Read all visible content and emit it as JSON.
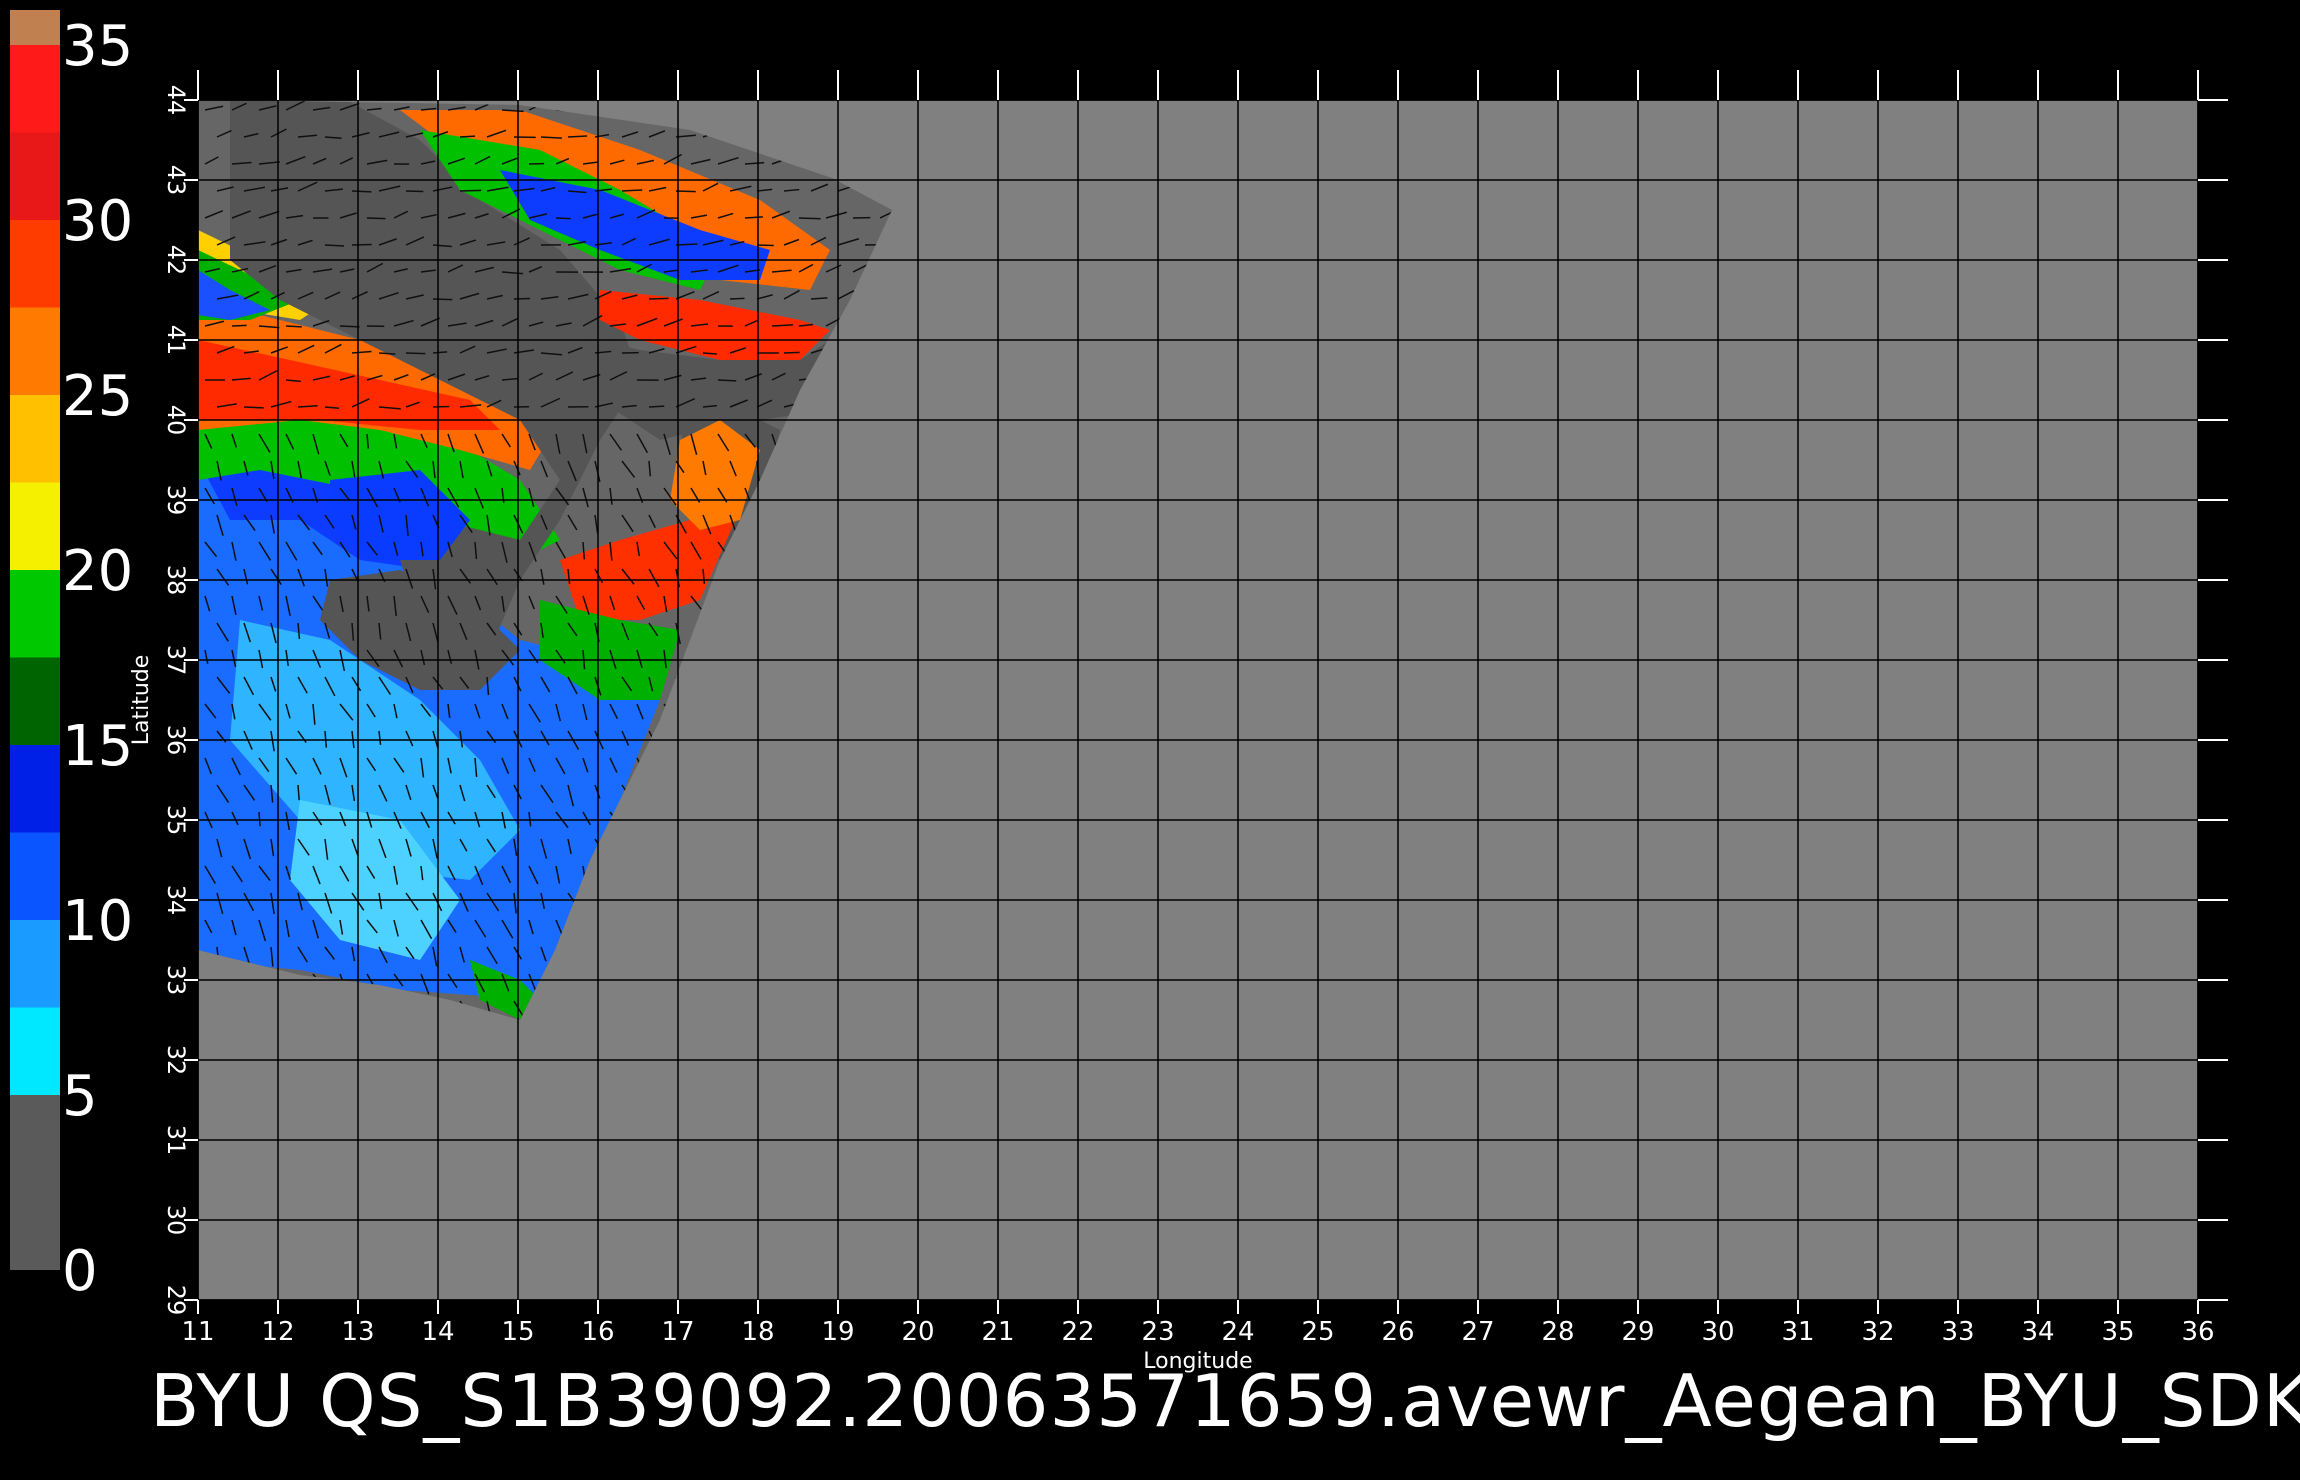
{
  "map": {
    "xlabel": "Longitude",
    "ylabel": "Latitude",
    "xlim": [
      11,
      36
    ],
    "ylim": [
      29,
      44
    ],
    "x_ticks": [
      "11",
      "12",
      "13",
      "14",
      "15",
      "16",
      "17",
      "18",
      "19",
      "20",
      "21",
      "22",
      "23",
      "24",
      "25",
      "26",
      "27",
      "28",
      "29",
      "30",
      "31",
      "32",
      "33",
      "34",
      "35",
      "36"
    ],
    "y_ticks": [
      "29",
      "30",
      "31",
      "32",
      "33",
      "34",
      "35",
      "36",
      "37",
      "38",
      "39",
      "40",
      "41",
      "42",
      "43",
      "44"
    ],
    "grid": true,
    "background_color": "#808080",
    "land_color": "#555555"
  },
  "colorbar": {
    "ticks": [
      "0",
      "5",
      "10",
      "15",
      "20",
      "25",
      "30",
      "35"
    ],
    "range": [
      0,
      35
    ],
    "segments": [
      {
        "from": 0,
        "to": 5,
        "color": "#5a5a5a"
      },
      {
        "from": 5,
        "to": 7.5,
        "color": "#00e8ff"
      },
      {
        "from": 7.5,
        "to": 10,
        "color": "#1a9bff"
      },
      {
        "from": 10,
        "to": 12.5,
        "color": "#0a55ff"
      },
      {
        "from": 12.5,
        "to": 15,
        "color": "#0020e8"
      },
      {
        "from": 15,
        "to": 17.5,
        "color": "#006400"
      },
      {
        "from": 17.5,
        "to": 20,
        "color": "#00c800"
      },
      {
        "from": 20,
        "to": 22.5,
        "color": "#f5f000"
      },
      {
        "from": 22.5,
        "to": 25,
        "color": "#ffc000"
      },
      {
        "from": 25,
        "to": 27.5,
        "color": "#ff7a00"
      },
      {
        "from": 27.5,
        "to": 30,
        "color": "#ff3c00"
      },
      {
        "from": 30,
        "to": 32.5,
        "color": "#e81818"
      },
      {
        "from": 32.5,
        "to": 35,
        "color": "#ff1a1a"
      },
      {
        "from": 35,
        "to": 36,
        "color": "#c08050"
      }
    ]
  },
  "title": "BYU  QS_S1B39092.20063571659.avewr_Aegean_BYU_SDK"
}
